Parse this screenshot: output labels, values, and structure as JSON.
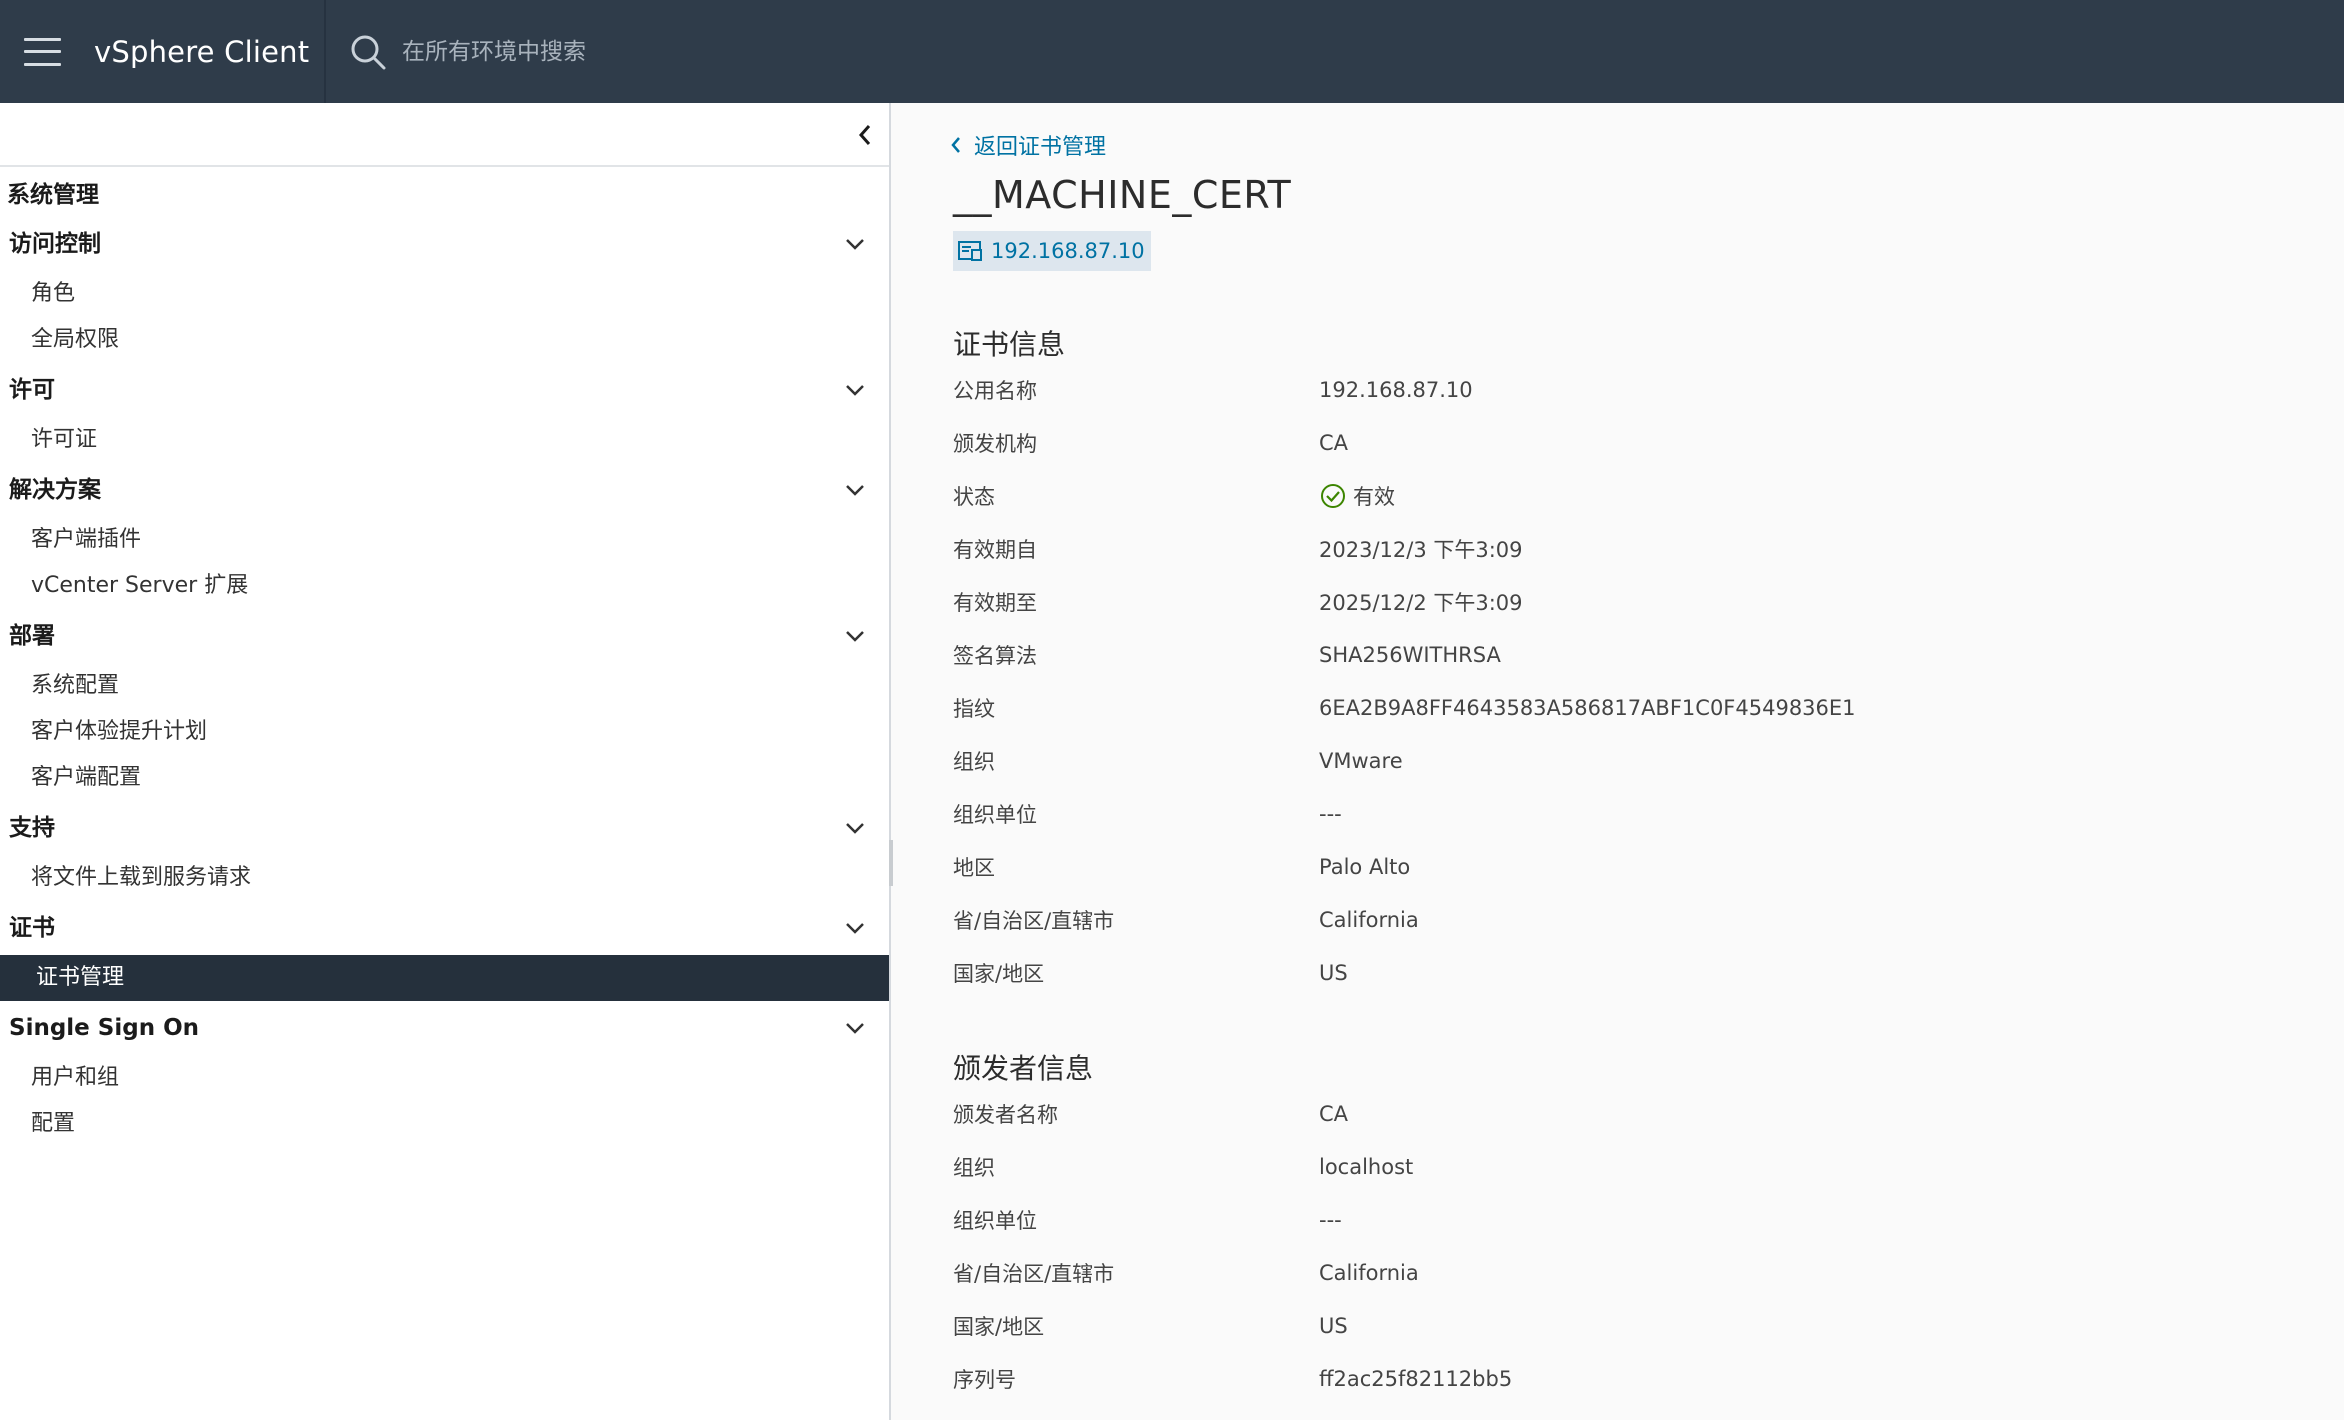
{
  "header": {
    "app_title": "vSphere Client",
    "search_placeholder": "在所有环境中搜索"
  },
  "sidebar": {
    "title": "系统管理",
    "groups": [
      {
        "label": "访问控制",
        "items": [
          "角色",
          "全局权限"
        ]
      },
      {
        "label": "许可",
        "items": [
          "许可证"
        ]
      },
      {
        "label": "解决方案",
        "items": [
          "客户端插件",
          "vCenter Server 扩展"
        ]
      },
      {
        "label": "部署",
        "items": [
          "系统配置",
          "客户体验提升计划",
          "客户端配置"
        ]
      },
      {
        "label": "支持",
        "items": [
          "将文件上载到服务请求"
        ]
      },
      {
        "label": "证书",
        "items": [
          "证书管理"
        ]
      },
      {
        "label": "Single Sign On",
        "items": [
          "用户和组",
          "配置"
        ]
      }
    ],
    "active_item": "证书管理"
  },
  "main": {
    "back_label": "返回证书管理",
    "title": "__MACHINE_CERT",
    "host": "192.168.87.10",
    "cert_info": {
      "title": "证书信息",
      "rows": [
        {
          "label": "公用名称",
          "value": "192.168.87.10"
        },
        {
          "label": "颁发机构",
          "value": "CA"
        },
        {
          "label": "状态",
          "value": "有效"
        },
        {
          "label": "有效期自",
          "value": "2023/12/3 下午3:09"
        },
        {
          "label": "有效期至",
          "value": "2025/12/2 下午3:09"
        },
        {
          "label": "签名算法",
          "value": "SHA256WITHRSA"
        },
        {
          "label": "指纹",
          "value": "6EA2B9A8FF4643583A586817ABF1C0F4549836E1"
        },
        {
          "label": "组织",
          "value": "VMware"
        },
        {
          "label": "组织单位",
          "value": "---"
        },
        {
          "label": "地区",
          "value": "Palo Alto"
        },
        {
          "label": "省/自治区/直辖市",
          "value": "California"
        },
        {
          "label": "国家/地区",
          "value": "US"
        }
      ]
    },
    "issuer_info": {
      "title": "颁发者信息",
      "rows": [
        {
          "label": "颁发者名称",
          "value": "CA"
        },
        {
          "label": "组织",
          "value": "localhost"
        },
        {
          "label": "组织单位",
          "value": "---"
        },
        {
          "label": "省/自治区/直辖市",
          "value": "California"
        },
        {
          "label": "国家/地区",
          "value": "US"
        },
        {
          "label": "序列号",
          "value": "ff2ac25f82112bb5"
        }
      ]
    }
  },
  "colors": {
    "header_bg": "#2f3c4a",
    "link": "#0072a3",
    "active_nav_bg": "#25303c",
    "status_ok": "#3c8500"
  },
  "icons": {
    "menu": "hamburger-icon",
    "search": "search-icon",
    "collapse": "chevron-left-icon",
    "group": "chevron-down-icon",
    "back": "chevron-left-icon",
    "host": "host-icon",
    "status": "check-circle-icon"
  }
}
